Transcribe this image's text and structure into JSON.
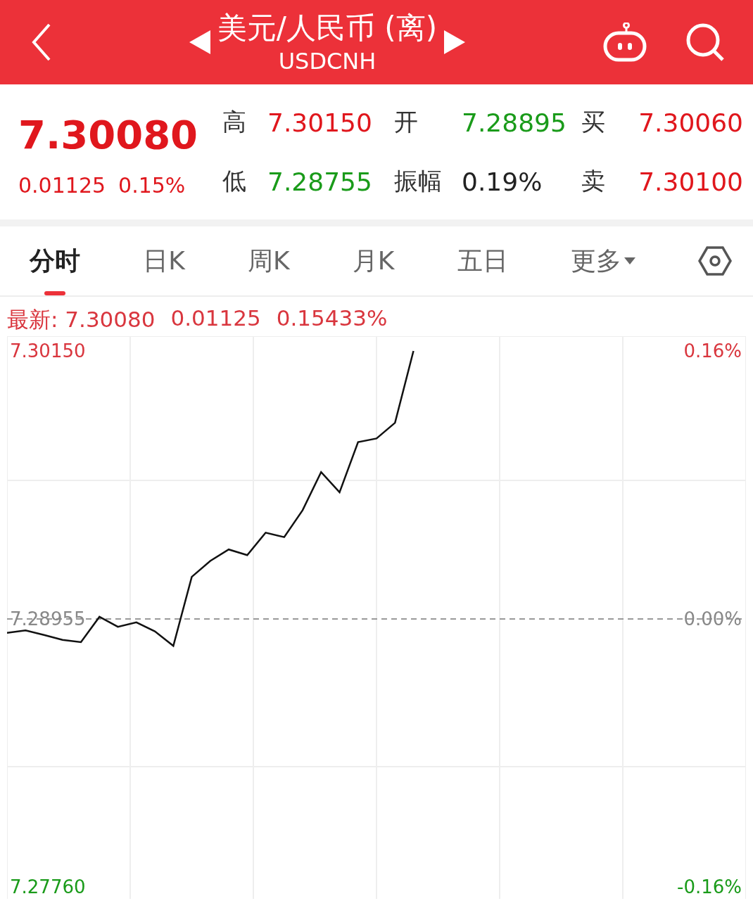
{
  "header": {
    "title": "美元/人民币 (离)",
    "subtitle": "USDCNH"
  },
  "quote": {
    "price": "7.30080",
    "change": "0.01125",
    "change_pct": "0.15%",
    "stats": [
      {
        "label": "高",
        "value": "7.30150",
        "color": "#e0171d"
      },
      {
        "label": "开",
        "value": "7.28895",
        "color": "#1a9b1a"
      },
      {
        "label": "买",
        "value": "7.30060",
        "color": "#e0171d"
      },
      {
        "label": "低",
        "value": "7.28755",
        "color": "#1a9b1a"
      },
      {
        "label": "振幅",
        "value": "0.19%",
        "color": "#222222"
      },
      {
        "label": "卖",
        "value": "7.30100",
        "color": "#e0171d"
      }
    ]
  },
  "tabs": [
    {
      "label": "分时",
      "selected": true
    },
    {
      "label": "日K",
      "selected": false
    },
    {
      "label": "周K",
      "selected": false
    },
    {
      "label": "月K",
      "selected": false
    },
    {
      "label": "五日",
      "selected": false
    },
    {
      "label": "更多",
      "selected": false,
      "kind": "dropdown"
    }
  ],
  "chart": {
    "latest": [
      "最新: 7.30080",
      "0.01125",
      "0.15433%"
    ],
    "percent_labels": [
      "0.16%",
      "0.00%",
      "-0.16%"
    ],
    "chart_data": {
      "type": "line",
      "ylim": [
        7.27707,
        7.30216
      ],
      "ref_lines": [
        {
          "axis": "y",
          "value": 7.28955
        }
      ],
      "yticks": [
        {
          "value": 7.3015,
          "label": "7.30150"
        },
        {
          "value": 7.28955,
          "label": "7.28955"
        },
        {
          "value": 7.2776,
          "label": "7.27760"
        }
      ],
      "categories": [
        null,
        null,
        null,
        null,
        null,
        null,
        null,
        null,
        null,
        null,
        null,
        null,
        null,
        null,
        null,
        null,
        null,
        null,
        null,
        null,
        null,
        null,
        null,
        null,
        null,
        null,
        null,
        null,
        null,
        null,
        null,
        null,
        null,
        null,
        null,
        null,
        null,
        null,
        null,
        null,
        null
      ],
      "series": [
        {
          "color": "#111111",
          "values": [
            7.28893,
            7.28904,
            7.28884,
            7.28862,
            7.28852,
            7.28965,
            7.2892,
            7.2894,
            7.289,
            7.28835,
            7.29143,
            7.29214,
            7.29265,
            7.2924,
            7.2934,
            7.2932,
            7.2944,
            7.2961,
            7.2952,
            7.29744,
            7.2976,
            7.2983,
            7.3015,
            null,
            null,
            null,
            null,
            null,
            null,
            null,
            null,
            null,
            null,
            null,
            null,
            null,
            null,
            null,
            null,
            null,
            null
          ]
        }
      ]
    }
  }
}
